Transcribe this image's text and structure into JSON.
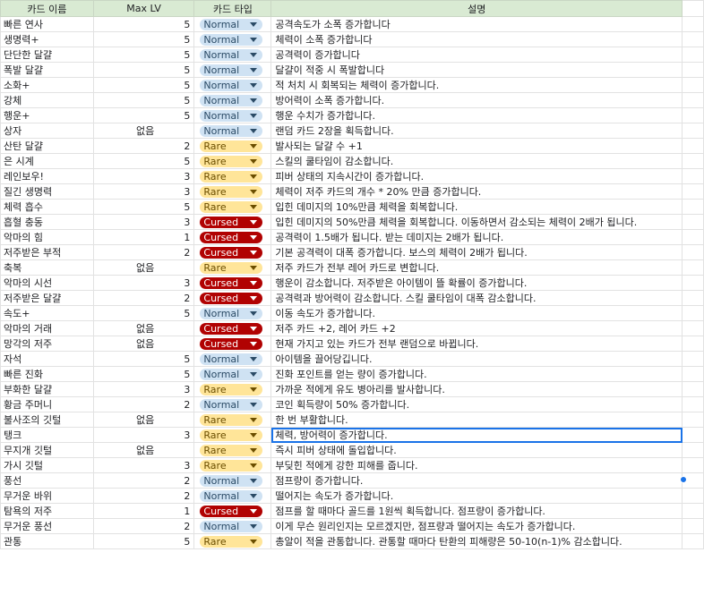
{
  "headers": {
    "name": "카드 이름",
    "max_lv": "Max LV",
    "type": "카드 타입",
    "desc": "설명"
  },
  "type_colors": {
    "Normal": "#cfe2f3",
    "Rare": "#ffe599",
    "Cursed": "#b10202",
    "header": "#d9ead3",
    "selection": "#1a73e8"
  },
  "rows": [
    {
      "name": "빠른 연사",
      "lv": "5",
      "type": "Normal",
      "desc": "공격속도가 소폭 증가합니다"
    },
    {
      "name": "생명력+",
      "lv": "5",
      "type": "Normal",
      "desc": "체력이 소폭 증가합니다"
    },
    {
      "name": "단단한 달걀",
      "lv": "5",
      "type": "Normal",
      "desc": "공격력이 증가합니다"
    },
    {
      "name": "폭발 달걀",
      "lv": "5",
      "type": "Normal",
      "desc": "달걀이 적중 시 폭발합니다"
    },
    {
      "name": "소화+",
      "lv": "5",
      "type": "Normal",
      "desc": "적 처치 시 회복되는 체력이 증가합니다."
    },
    {
      "name": "강체",
      "lv": "5",
      "type": "Normal",
      "desc": "방어력이 소폭 증가합니다."
    },
    {
      "name": "행운+",
      "lv": "5",
      "type": "Normal",
      "desc": "행운 수치가 증가합니다."
    },
    {
      "name": "상자",
      "lv": "없음",
      "type": "Normal",
      "desc": "랜덤 카드 2장을 획득합니다."
    },
    {
      "name": "산탄 달걀",
      "lv": "2",
      "type": "Rare",
      "desc": "발사되는 달걀 수 +1"
    },
    {
      "name": "은 시계",
      "lv": "5",
      "type": "Rare",
      "desc": "스킬의 쿨타임이 감소합니다."
    },
    {
      "name": "레인보우!",
      "lv": "3",
      "type": "Rare",
      "desc": "피버 상태의 지속시간이 증가합니다."
    },
    {
      "name": "질긴 생명력",
      "lv": "3",
      "type": "Rare",
      "desc": "체력이 저주 카드의 개수 * 20% 만큼 증가합니다."
    },
    {
      "name": "체력 흡수",
      "lv": "5",
      "type": "Rare",
      "desc": "입힌 데미지의 10%만큼 체력을 회복합니다."
    },
    {
      "name": "흡혈 충동",
      "lv": "3",
      "type": "Cursed",
      "desc": "입힌 데미지의 50%만큼 체력을 회복합니다. 이동하면서 감소되는 체력이 2배가 됩니다."
    },
    {
      "name": "악마의 힘",
      "lv": "1",
      "type": "Cursed",
      "desc": "공격력이 1.5배가 됩니다. 받는 데미지는 2배가 됩니다."
    },
    {
      "name": "저주받은 부적",
      "lv": "2",
      "type": "Cursed",
      "desc": "기본 공격력이 대폭 증가합니다. 보스의 체력이 2배가 됩니다."
    },
    {
      "name": "축복",
      "lv": "없음",
      "type": "Rare",
      "desc": "저주 카드가 전부 레어 카드로 변합니다."
    },
    {
      "name": "악마의 시선",
      "lv": "3",
      "type": "Cursed",
      "desc": "행운이 감소합니다. 저주받은 아이템이 뜰 확률이 증가합니다."
    },
    {
      "name": "저주받은 달걀",
      "lv": "2",
      "type": "Cursed",
      "desc": "공격력과 방어력이 감소합니다. 스킬 쿨타임이 대폭 감소합니다."
    },
    {
      "name": "속도+",
      "lv": "5",
      "type": "Normal",
      "desc": "이동 속도가 증가합니다."
    },
    {
      "name": "악마의 거래",
      "lv": "없음",
      "type": "Cursed",
      "desc": "저주 카드 +2, 레어 카드 +2"
    },
    {
      "name": "망각의 저주",
      "lv": "없음",
      "type": "Cursed",
      "desc": "현재 가지고 있는 카드가 전부 랜덤으로 바뀝니다."
    },
    {
      "name": "자석",
      "lv": "5",
      "type": "Normal",
      "desc": "아이템을 끌어당깁니다."
    },
    {
      "name": "빠른 진화",
      "lv": "5",
      "type": "Normal",
      "desc": "진화 포인트를 얻는 량이 증가합니다."
    },
    {
      "name": "부화한 달걀",
      "lv": "3",
      "type": "Rare",
      "desc": "가까운 적에게 유도 병아리를 발사합니다."
    },
    {
      "name": "황금 주머니",
      "lv": "2",
      "type": "Normal",
      "desc": "코인 획득량이 50% 증가합니다."
    },
    {
      "name": "불사조의 깃털",
      "lv": "없음",
      "type": "Rare",
      "desc": "한 번 부활합니다."
    },
    {
      "name": "탱크",
      "lv": "3",
      "type": "Rare",
      "desc": "체력, 방어력이 증가합니다."
    },
    {
      "name": "무지개 깃털",
      "lv": "없음",
      "type": "Rare",
      "desc": "즉시 피버 상태에 돌입합니다."
    },
    {
      "name": "가시 깃털",
      "lv": "3",
      "type": "Rare",
      "desc": "부딪힌 적에게 강한 피해를 줍니다."
    },
    {
      "name": "풍선",
      "lv": "2",
      "type": "Normal",
      "desc": "점프량이 증가합니다."
    },
    {
      "name": "무거운 바위",
      "lv": "2",
      "type": "Normal",
      "desc": "떨어지는 속도가 증가합니다."
    },
    {
      "name": "탐욕의 저주",
      "lv": "1",
      "type": "Cursed",
      "desc": "점프를 할 때마다 골드를 1원씩 획득합니다. 점프량이 증가합니다."
    },
    {
      "name": "무거운 풍선",
      "lv": "2",
      "type": "Normal",
      "desc": "이게 무슨 원리인지는 모르겠지만, 점프량과 떨어지는 속도가 증가합니다."
    },
    {
      "name": "관통",
      "lv": "5",
      "type": "Rare",
      "desc": "총알이 적을 관통합니다. 관통할 때마다 탄환의 피해량은 50-10(n-1)% 감소합니다."
    }
  ]
}
